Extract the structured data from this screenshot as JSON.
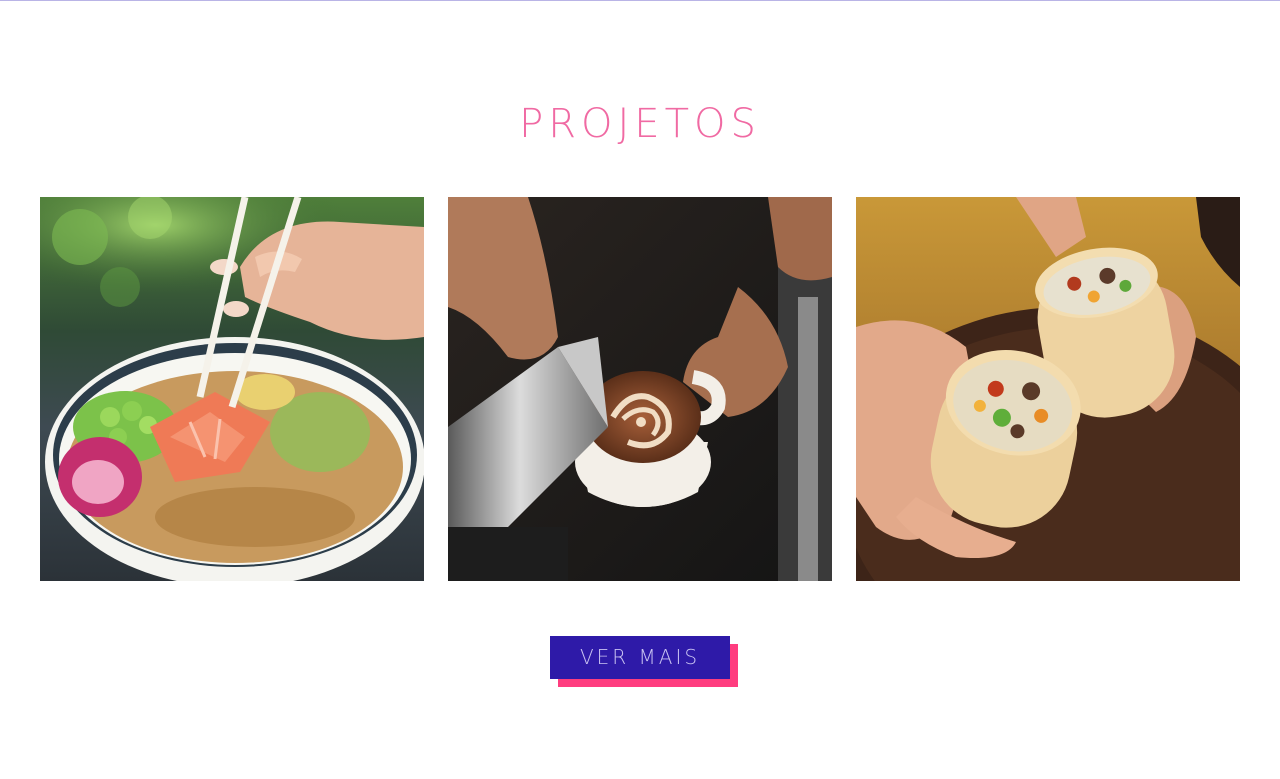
{
  "section": {
    "title": "PROJETOS"
  },
  "projects": [
    {
      "name": "poke-bowl-photo",
      "icon": "poke-bowl-image"
    },
    {
      "name": "latte-art-photo",
      "icon": "latte-art-image"
    },
    {
      "name": "burrito-photo",
      "icon": "burrito-image"
    }
  ],
  "cta": {
    "label": "VER MAIS"
  },
  "colors": {
    "title": "#f06aa3",
    "button_bg": "#2e1aa8",
    "button_text": "#c9c3f2",
    "button_shadow": "#ff3d7f",
    "top_rule": "#b9b4e6"
  }
}
